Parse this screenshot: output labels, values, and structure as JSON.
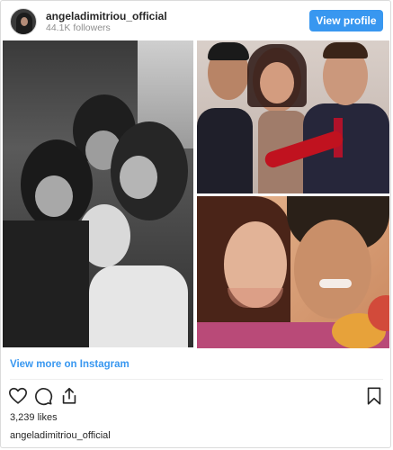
{
  "header": {
    "username": "angeladimitriou_official",
    "followers": "44.1K followers",
    "view_profile_label": "View profile"
  },
  "post": {
    "view_more_label": "View more on Instagram",
    "likes": "3,239 likes",
    "owner": "angeladimitriou_official"
  },
  "icons": {
    "like": "heart-icon",
    "comment": "comment-icon",
    "share": "share-icon",
    "save": "bookmark-icon"
  },
  "colors": {
    "accent": "#3897f0",
    "text": "#262626",
    "muted": "#8e8e8e",
    "border": "#dbdbdb"
  }
}
